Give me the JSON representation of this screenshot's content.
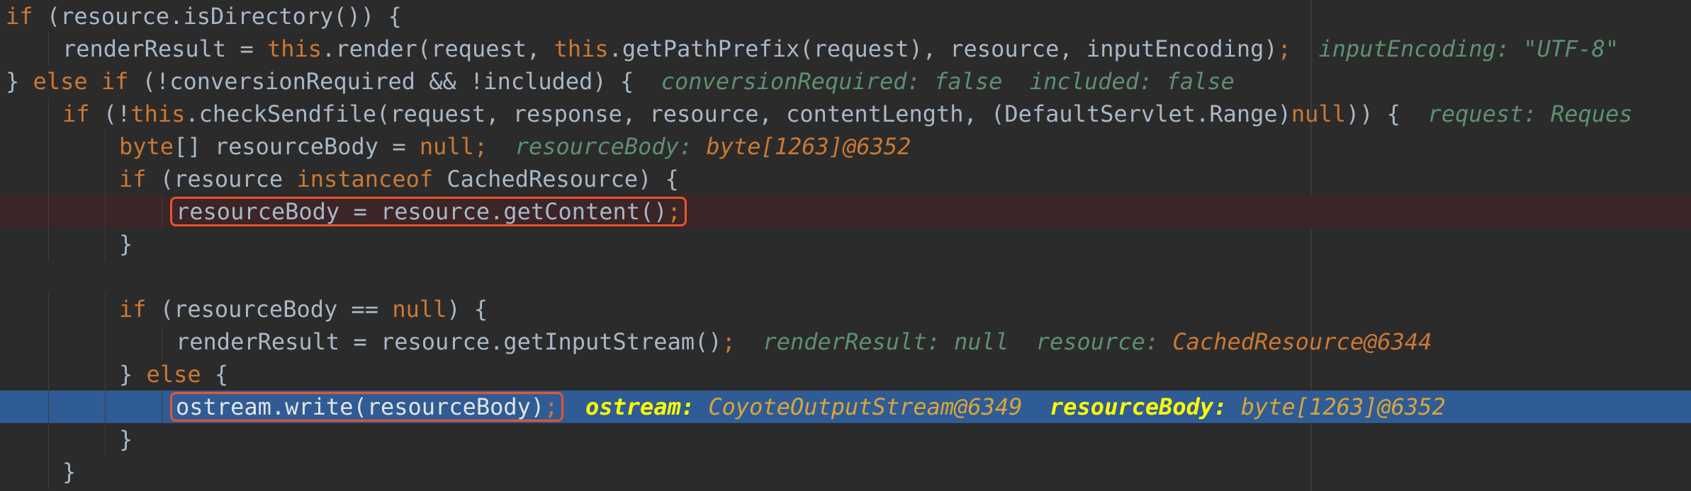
{
  "editor": {
    "accent": "#2f5c95",
    "breakpoint_bg": "#3b2526",
    "highlight_box_color": "#e8542f",
    "lines": [
      {
        "indent": 0,
        "tokens": [
          {
            "t": "if",
            "c": "kw"
          },
          {
            "t": " (resource.isDirectory()) {",
            "c": "plain"
          }
        ]
      },
      {
        "indent": 1,
        "tokens": [
          {
            "t": "renderResult = ",
            "c": "plain"
          },
          {
            "t": "this",
            "c": "kw"
          },
          {
            "t": ".render(request, ",
            "c": "plain"
          },
          {
            "t": "this",
            "c": "kw"
          },
          {
            "t": ".getPathPrefix(request), resource, inputEncoding)",
            "c": "plain"
          },
          {
            "t": ";",
            "c": "kw"
          },
          {
            "t": "  ",
            "c": "plain"
          },
          {
            "t": "inputEncoding: ",
            "c": "hint-name"
          },
          {
            "t": "\"UTF-8\"",
            "c": "hint-val"
          }
        ]
      },
      {
        "indent": 0,
        "tokens": [
          {
            "t": "} ",
            "c": "plain"
          },
          {
            "t": "else if",
            "c": "kw"
          },
          {
            "t": " (!conversionRequired && !included) {",
            "c": "plain"
          },
          {
            "t": "  ",
            "c": "plain"
          },
          {
            "t": "conversionRequired: ",
            "c": "hint-name"
          },
          {
            "t": "false",
            "c": "hint-val"
          },
          {
            "t": "  ",
            "c": "plain"
          },
          {
            "t": "included: ",
            "c": "hint-name"
          },
          {
            "t": "false",
            "c": "hint-val"
          }
        ]
      },
      {
        "indent": 1,
        "tokens": [
          {
            "t": "if",
            "c": "kw"
          },
          {
            "t": " (!",
            "c": "plain"
          },
          {
            "t": "this",
            "c": "kw"
          },
          {
            "t": ".checkSendfile(request, response, resource, contentLength, (DefaultServlet.Range)",
            "c": "plain"
          },
          {
            "t": "null",
            "c": "kw"
          },
          {
            "t": ")) {",
            "c": "plain"
          },
          {
            "t": "  ",
            "c": "plain"
          },
          {
            "t": "request: Reques",
            "c": "hint-name"
          }
        ]
      },
      {
        "indent": 2,
        "tokens": [
          {
            "t": "byte",
            "c": "kw"
          },
          {
            "t": "[] resourceBody = ",
            "c": "plain"
          },
          {
            "t": "null",
            "c": "kw"
          },
          {
            "t": ";",
            "c": "kw"
          },
          {
            "t": "  ",
            "c": "plain"
          },
          {
            "t": "resourceBody: ",
            "c": "hint-name"
          },
          {
            "t": "byte[1263]@6352",
            "c": "hint-obj"
          }
        ]
      },
      {
        "indent": 2,
        "tokens": [
          {
            "t": "if",
            "c": "kw"
          },
          {
            "t": " (resource ",
            "c": "plain"
          },
          {
            "t": "instanceof",
            "c": "kw"
          },
          {
            "t": " CachedResource) {",
            "c": "plain"
          }
        ]
      },
      {
        "indent": 3,
        "state": "breakpoint",
        "boxed": true,
        "tokens": [
          {
            "t": "resourceBody = resource.getContent()",
            "c": "plain"
          },
          {
            "t": ";",
            "c": "kw"
          }
        ]
      },
      {
        "indent": 2,
        "tokens": [
          {
            "t": "}",
            "c": "plain"
          }
        ]
      },
      {
        "indent": 0,
        "tokens": []
      },
      {
        "indent": 2,
        "tokens": [
          {
            "t": "if",
            "c": "kw"
          },
          {
            "t": " (resourceBody == ",
            "c": "plain"
          },
          {
            "t": "null",
            "c": "kw"
          },
          {
            "t": ") {",
            "c": "plain"
          }
        ]
      },
      {
        "indent": 3,
        "tokens": [
          {
            "t": "renderResult = resource.getInputStream()",
            "c": "plain"
          },
          {
            "t": ";",
            "c": "kw"
          },
          {
            "t": "  ",
            "c": "plain"
          },
          {
            "t": "renderResult: ",
            "c": "hint-name"
          },
          {
            "t": "null",
            "c": "hint-val"
          },
          {
            "t": "  ",
            "c": "plain"
          },
          {
            "t": "resource: ",
            "c": "hint-name"
          },
          {
            "t": "CachedResource@6344",
            "c": "hint-obj"
          }
        ]
      },
      {
        "indent": 2,
        "tokens": [
          {
            "t": "} ",
            "c": "plain"
          },
          {
            "t": "else",
            "c": "kw"
          },
          {
            "t": " {",
            "c": "plain"
          }
        ]
      },
      {
        "indent": 3,
        "state": "current",
        "boxed": true,
        "tokens": [
          {
            "t": "ostream.write(resourceBody)",
            "c": "plain"
          },
          {
            "t": ";",
            "c": "kw"
          },
          {
            "t": "  ",
            "c": "plain"
          },
          {
            "t": "ostream: ",
            "c": "hint-name-active"
          },
          {
            "t": "CoyoteOutputStream@6349",
            "c": "hint-obj-active"
          },
          {
            "t": "  ",
            "c": "plain"
          },
          {
            "t": "resourceBody: ",
            "c": "hint-name-active"
          },
          {
            "t": "byte[1263]@6352",
            "c": "hint-obj-active"
          }
        ]
      },
      {
        "indent": 2,
        "tokens": [
          {
            "t": "}",
            "c": "plain"
          }
        ]
      },
      {
        "indent": 1,
        "tokens": [
          {
            "t": "}",
            "c": "plain"
          }
        ]
      }
    ]
  }
}
